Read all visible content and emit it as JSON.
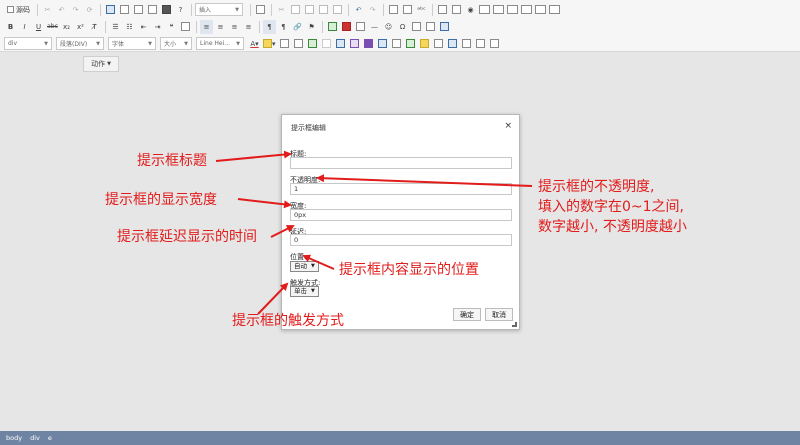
{
  "toolbar": {
    "source_label": "源码",
    "insert_select": "插入",
    "block_select": "div",
    "paragraph_select": "段落(DIV)",
    "font_select": "字体",
    "size_select": "大小",
    "lineheight_select": "Line Hei..."
  },
  "action_button": "动作",
  "dialog": {
    "title": "提示框编辑",
    "close": "×",
    "title_label": "标题:",
    "title_value": "",
    "opacity_label": "不透明度:",
    "opacity_value": "1",
    "width_label": "宽度:",
    "width_value": "0px",
    "delay_label": "延迟:",
    "delay_value": "0",
    "position_label": "位置:",
    "position_value": "自动",
    "trigger_label": "触发方式:",
    "trigger_value": "单击",
    "ok": "确定",
    "cancel": "取消"
  },
  "annotations": {
    "title_note": "提示框标题",
    "opacity_note_1": "提示框的不透明度,",
    "opacity_note_2": "填入的数字在0~1之间,",
    "opacity_note_3": "数字越小, 不透明度越小",
    "width_note": "提示框的显示宽度",
    "delay_note": "提示框延迟显示的时间",
    "position_note": "提示框内容显示的位置",
    "trigger_note": "提示框的触发方式"
  },
  "colors": {
    "annotation": "#e21b1b",
    "statusbar": "#6f84a3"
  },
  "statusbar": {
    "crumbs": [
      "body",
      "div",
      "e"
    ]
  }
}
